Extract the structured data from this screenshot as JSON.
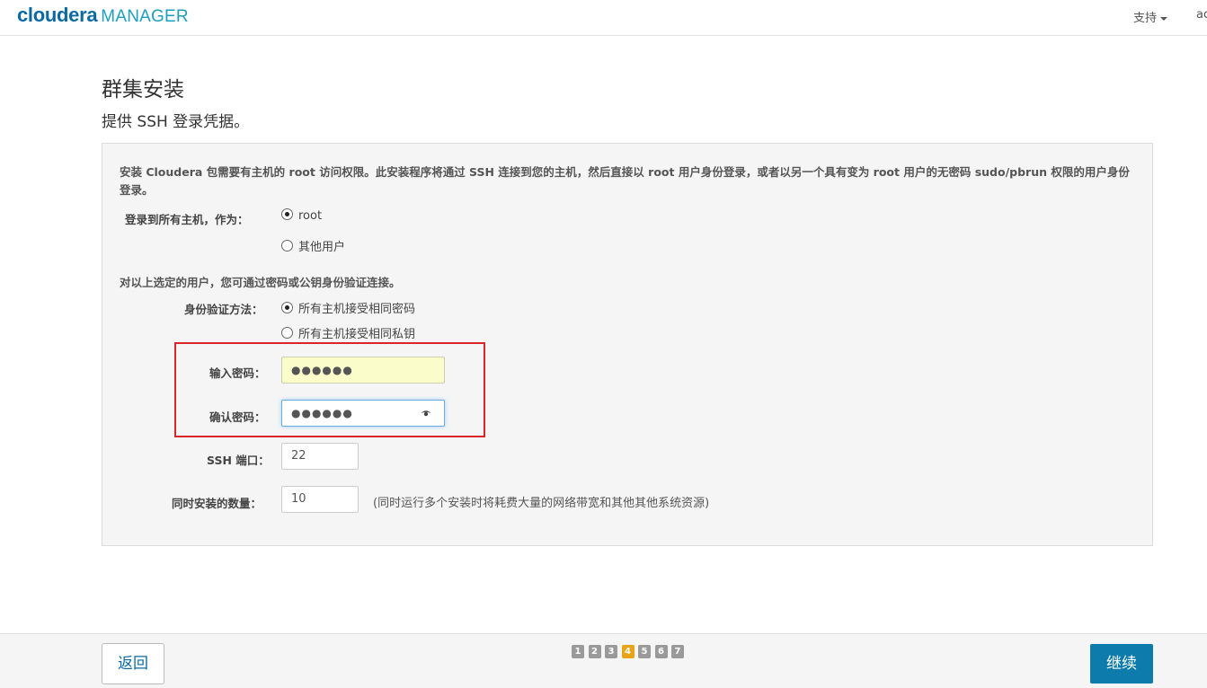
{
  "header": {
    "brand": "cloudera",
    "product": "MANAGER",
    "support_label": "支持",
    "user_label": "ac"
  },
  "page": {
    "title": "群集安装",
    "subtitle": "提供 SSH 登录凭据。"
  },
  "form": {
    "intro": "安装 Cloudera 包需要有主机的 root 访问权限。此安装程序将通过 SSH 连接到您的主机，然后直接以 root 用户身份登录，或者以另一个具有变为 root 用户的无密码 sudo/pbrun 权限的用户身份登录。",
    "login_as_label": "登录到所有主机，作为：",
    "login_options": [
      "root",
      "其他用户"
    ],
    "login_selected": "root",
    "auth_note": "对以上选定的用户，您可通过密码或公钥身份验证连接。",
    "auth_method_label": "身份验证方法：",
    "auth_options": [
      "所有主机接受相同密码",
      "所有主机接受相同私钥"
    ],
    "auth_selected": "所有主机接受相同密码",
    "password_label": "输入密码：",
    "password_value": "●●●●●●",
    "confirm_label": "确认密码：",
    "confirm_value": "●●●●●●",
    "ssh_port_label": "SSH 端口：",
    "ssh_port_value": "22",
    "concurrent_label": "同时安装的数量：",
    "concurrent_value": "10",
    "concurrent_hint": "(同时运行多个安装时将耗费大量的网络带宽和其他其他系统资源)"
  },
  "footer": {
    "back_label": "返回",
    "continue_label": "继续",
    "steps": [
      "1",
      "2",
      "3",
      "4",
      "5",
      "6",
      "7"
    ],
    "current_step": "4"
  },
  "colors": {
    "brand": "#0a6aa1",
    "accent": "#0d7cad",
    "active_step": "#e8a317",
    "annotation": "#d9262b",
    "autofill": "#fafcc9"
  },
  "icons": {
    "password_reveal": "eye-icon",
    "support_menu": "caret-down-icon"
  }
}
